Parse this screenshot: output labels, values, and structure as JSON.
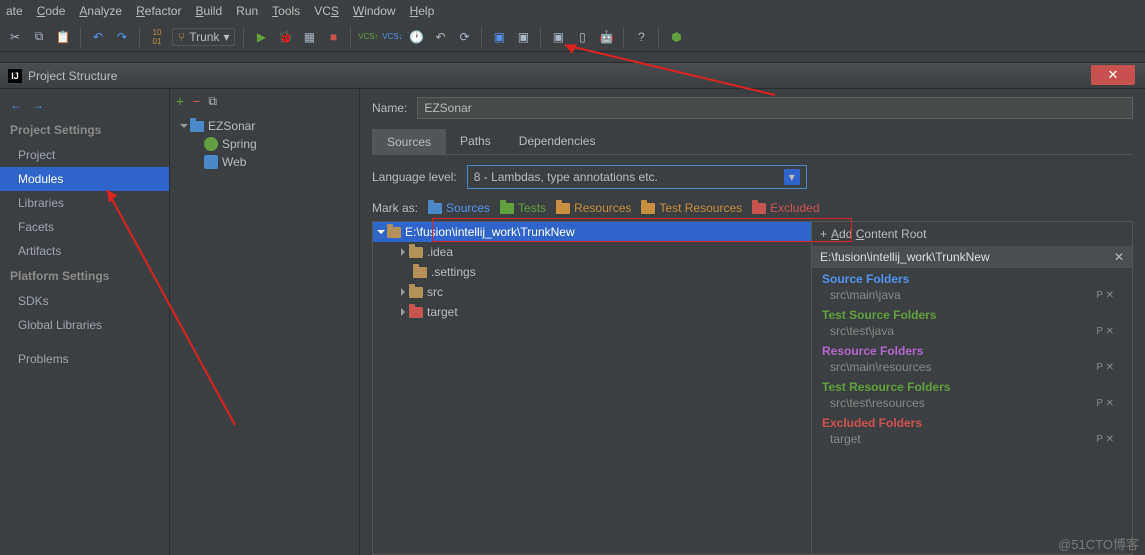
{
  "menu": {
    "items": [
      "ate",
      "Code",
      "Analyze",
      "Refactor",
      "Build",
      "Run",
      "Tools",
      "VCS",
      "Window",
      "Help"
    ],
    "underlines": [
      "",
      "C",
      "A",
      "R",
      "B",
      "",
      "T",
      "S",
      "W",
      "H"
    ]
  },
  "dialog": {
    "title": "Project Structure"
  },
  "sidebar": {
    "h1": "Project Settings",
    "h2": "Platform Settings",
    "items1": [
      "Project",
      "Modules",
      "Libraries",
      "Facets",
      "Artifacts"
    ],
    "items2": [
      "SDKs",
      "Global Libraries"
    ],
    "problems": "Problems"
  },
  "mid": {
    "module": "EZSonar",
    "nodes": [
      "Spring",
      "Web"
    ]
  },
  "main": {
    "nameLabel": "Name:",
    "nameValue": "EZSonar",
    "tabs": [
      "Sources",
      "Paths",
      "Dependencies"
    ],
    "langLabel": "Language level:",
    "langValue": "8 - Lambdas, type annotations etc.",
    "markLabel": "Mark as:",
    "marks": [
      "Sources",
      "Tests",
      "Resources",
      "Test Resources",
      "Excluded"
    ],
    "rootPath": "E:\\fusion\\intellij_work\\TrunkNew",
    "folders": [
      ".idea",
      ".settings",
      "src",
      "target"
    ]
  },
  "right": {
    "add": "Add Content Root",
    "root": "E:\\fusion\\intellij_work\\TrunkNew",
    "cats": [
      {
        "t": "Source Folders",
        "cls": "blue",
        "items": [
          "src\\main\\java"
        ]
      },
      {
        "t": "Test Source Folders",
        "cls": "green",
        "items": [
          "src\\test\\java"
        ]
      },
      {
        "t": "Resource Folders",
        "cls": "purple",
        "items": [
          "src\\main\\resources"
        ]
      },
      {
        "t": "Test Resource Folders",
        "cls": "teal",
        "items": [
          "src\\test\\resources"
        ]
      },
      {
        "t": "Excluded Folders",
        "cls": "red",
        "items": [
          "target"
        ]
      }
    ]
  },
  "trunk": "Trunk",
  "watermark": "@51CTO博客"
}
